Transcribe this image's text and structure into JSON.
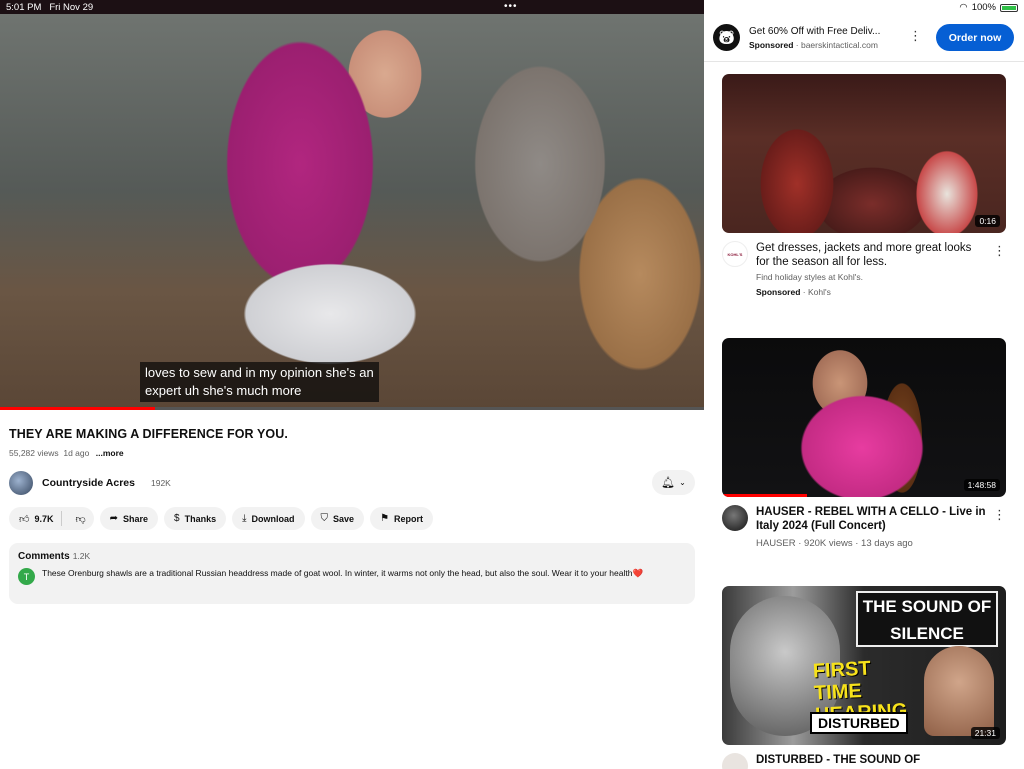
{
  "status_bar": {
    "time": "5:01 PM",
    "date": "Fri Nov 29",
    "dots": "•••",
    "battery": "100%"
  },
  "player": {
    "caption_line1": "loves to sew and in my opinion she's an",
    "caption_line2": "expert uh she's much more",
    "progress_fraction": 0.22
  },
  "video": {
    "title": "THEY ARE MAKING A DIFFERENCE FOR YOU.",
    "views": "55,282 views",
    "age": "1d ago",
    "more": "...more"
  },
  "channel": {
    "name": "Countryside Acres",
    "subs": "192K",
    "bell_icon": "bell-icon",
    "chevron_icon": "chevron-down-icon"
  },
  "actions": {
    "likes": "9.7K",
    "share": "Share",
    "thanks": "Thanks",
    "download": "Download",
    "save": "Save",
    "report": "Report"
  },
  "comments": {
    "label": "Comments",
    "count": "1.2K",
    "avatar_letter": "T",
    "text": "These Orenburg shawls are a traditional Russian headdress made of goat wool. In winter, it warms not only the head, but also the soul. Wear it to your health",
    "emoji": "❤️"
  },
  "top_ad": {
    "title": "Get 60% Off with Free Deliv...",
    "sponsored": "Sponsored",
    "domain": "baerskintactical.com",
    "cta": "Order now"
  },
  "feed": [
    {
      "duration": "0:16",
      "title": "Get dresses, jackets and more great looks for the season all for less.",
      "desc": "Find holiday styles at Kohl's.",
      "sponsored": "Sponsored",
      "advertiser": "Kohl's",
      "logo_text": "KOHL'S"
    },
    {
      "duration": "1:48:58",
      "title": "HAUSER - REBEL WITH A CELLO - Live in Italy 2024 (Full Concert)",
      "meta": "HAUSER · 920K views · 13 days ago",
      "watched_fraction": 0.3
    },
    {
      "duration": "21:31",
      "title": "DISTURBED - THE SOUND OF",
      "thumb_box": "THE SOUND OF SILENCE",
      "thumb_ft": "FIRST TIME HEARING",
      "thumb_dist": "DISTURBED"
    }
  ],
  "colors": {
    "accent_blue": "#065fd4",
    "progress_red": "#ff0000",
    "pill_bg": "#f2f2f2"
  }
}
